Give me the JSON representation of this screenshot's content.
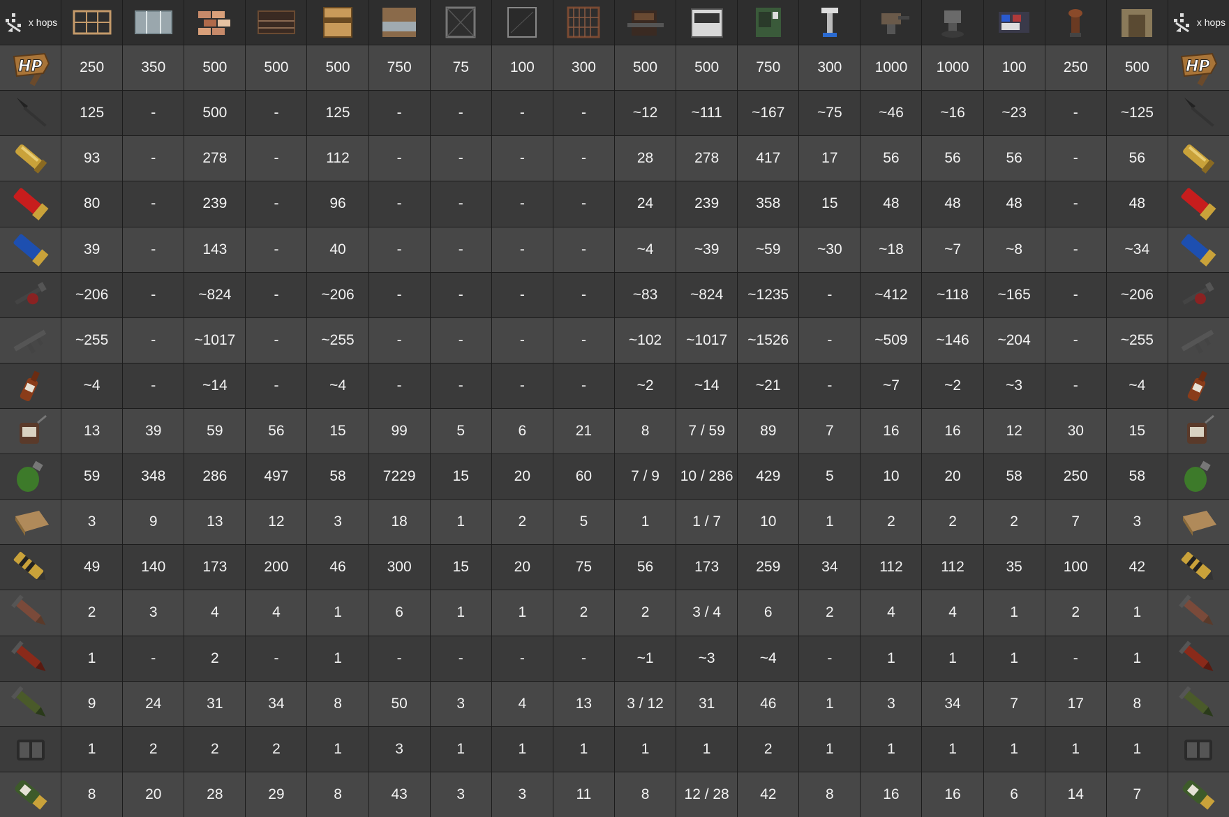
{
  "corner_label": "x hops",
  "hp_label": "HP",
  "colors": {
    "bg_dark": "#3a3a3a",
    "bg_light": "#474747",
    "header": "#2e2e2e",
    "text": "#f2f2f2"
  },
  "targets": [
    {
      "name": "wooden-window-bars",
      "icon": "window-frame-icon"
    },
    {
      "name": "reinforced-glass-window",
      "icon": "glass-window-icon"
    },
    {
      "name": "stone-wall-mixed",
      "icon": "brick-stack-icon"
    },
    {
      "name": "metal-window-bars",
      "icon": "metal-window-bars-icon"
    },
    {
      "name": "wooden-door",
      "icon": "wood-door-icon"
    },
    {
      "name": "armored-door",
      "icon": "garage-door-icon"
    },
    {
      "name": "wire-fence",
      "icon": "wire-fence-icon"
    },
    {
      "name": "glass-panel",
      "icon": "glass-panel-icon"
    },
    {
      "name": "jail-bars",
      "icon": "jail-bars-icon"
    },
    {
      "name": "workbench",
      "icon": "workbench-icon"
    },
    {
      "name": "shop-front",
      "icon": "shop-front-icon"
    },
    {
      "name": "vending-machine",
      "icon": "vending-machine-icon"
    },
    {
      "name": "tesla-coil",
      "icon": "tesla-coil-icon"
    },
    {
      "name": "auto-turret",
      "icon": "auto-turret-icon"
    },
    {
      "name": "sam-site",
      "icon": "sam-site-icon"
    },
    {
      "name": "shelves",
      "icon": "shelves-icon"
    },
    {
      "name": "flame-turret",
      "icon": "flame-turret-icon"
    },
    {
      "name": "wooden-wall-frame",
      "icon": "wall-frame-icon"
    }
  ],
  "rows": [
    {
      "icon": "hp-hammer-icon",
      "values": [
        "250",
        "350",
        "500",
        "500",
        "500",
        "750",
        "75",
        "100",
        "300",
        "500",
        "500",
        "750",
        "300",
        "1000",
        "1000",
        "100",
        "250",
        "500"
      ]
    },
    {
      "icon": "spear-icon",
      "values": [
        "125",
        "-",
        "500",
        "-",
        "125",
        "-",
        "-",
        "-",
        "-",
        "~12",
        "~111",
        "~167",
        "~75",
        "~46",
        "~16",
        "~23",
        "-",
        "~125"
      ]
    },
    {
      "icon": "brass-shell-icon",
      "values": [
        "93",
        "-",
        "278",
        "-",
        "112",
        "-",
        "-",
        "-",
        "-",
        "28",
        "278",
        "417",
        "17",
        "56",
        "56",
        "56",
        "-",
        "56"
      ]
    },
    {
      "icon": "red-shotgun-shell-icon",
      "values": [
        "80",
        "-",
        "239",
        "-",
        "96",
        "-",
        "-",
        "-",
        "-",
        "24",
        "239",
        "358",
        "15",
        "48",
        "48",
        "48",
        "-",
        "48"
      ]
    },
    {
      "icon": "blue-shotgun-shell-icon",
      "values": [
        "39",
        "-",
        "143",
        "-",
        "40",
        "-",
        "-",
        "-",
        "-",
        "~4",
        "~39",
        "~59",
        "~30",
        "~18",
        "~7",
        "~8",
        "-",
        "~34"
      ]
    },
    {
      "icon": "flamethrower-icon",
      "values": [
        "~206",
        "-",
        "~824",
        "-",
        "~206",
        "-",
        "-",
        "-",
        "-",
        "~83",
        "~824",
        "~1235",
        "-",
        "~412",
        "~118",
        "~165",
        "-",
        "~206"
      ]
    },
    {
      "icon": "smg-icon",
      "values": [
        "~255",
        "-",
        "~1017",
        "-",
        "~255",
        "-",
        "-",
        "-",
        "-",
        "~102",
        "~1017",
        "~1526",
        "-",
        "~509",
        "~146",
        "~204",
        "-",
        "~255"
      ]
    },
    {
      "icon": "molotov-icon",
      "values": [
        "~4",
        "-",
        "~14",
        "-",
        "~4",
        "-",
        "-",
        "-",
        "-",
        "~2",
        "~14",
        "~21",
        "-",
        "~7",
        "~2",
        "~3",
        "-",
        "~4"
      ]
    },
    {
      "icon": "beancan-grenade-icon",
      "values": [
        "13",
        "39",
        "59",
        "56",
        "15",
        "99",
        "5",
        "6",
        "21",
        "8",
        "7 / 59",
        "89",
        "7",
        "16",
        "16",
        "12",
        "30",
        "15"
      ]
    },
    {
      "icon": "f1-grenade-icon",
      "values": [
        "59",
        "348",
        "286",
        "497",
        "58",
        "7229",
        "15",
        "20",
        "60",
        "7 / 9",
        "10 / 286",
        "429",
        "5",
        "10",
        "20",
        "58",
        "250",
        "58"
      ]
    },
    {
      "icon": "satchel-charge-icon",
      "values": [
        "3",
        "9",
        "13",
        "12",
        "3",
        "18",
        "1",
        "2",
        "5",
        "1",
        "1 / 7",
        "10",
        "1",
        "2",
        "2",
        "2",
        "7",
        "3"
      ]
    },
    {
      "icon": "explosive-ammo-icon",
      "values": [
        "49",
        "140",
        "173",
        "200",
        "46",
        "300",
        "15",
        "20",
        "75",
        "56",
        "173",
        "259",
        "34",
        "112",
        "112",
        "35",
        "100",
        "42"
      ]
    },
    {
      "icon": "rocket-icon",
      "values": [
        "2",
        "3",
        "4",
        "4",
        "1",
        "6",
        "1",
        "1",
        "2",
        "2",
        "3 / 4",
        "6",
        "2",
        "4",
        "4",
        "1",
        "2",
        "1"
      ]
    },
    {
      "icon": "incendiary-rocket-icon",
      "values": [
        "1",
        "-",
        "2",
        "-",
        "1",
        "-",
        "-",
        "-",
        "-",
        "~1",
        "~3",
        "~4",
        "-",
        "1",
        "1",
        "1",
        "-",
        "1"
      ]
    },
    {
      "icon": "hv-rocket-icon",
      "values": [
        "9",
        "24",
        "31",
        "34",
        "8",
        "50",
        "3",
        "4",
        "13",
        "3 / 12",
        "31",
        "46",
        "1",
        "3",
        "34",
        "7",
        "17",
        "8"
      ]
    },
    {
      "icon": "c4-timed-explosive-icon",
      "values": [
        "1",
        "2",
        "2",
        "2",
        "1",
        "3",
        "1",
        "1",
        "1",
        "1",
        "1",
        "2",
        "1",
        "1",
        "1",
        "1",
        "1",
        "1"
      ]
    },
    {
      "icon": "grenade-launcher-he-icon",
      "values": [
        "8",
        "20",
        "28",
        "29",
        "8",
        "43",
        "3",
        "3",
        "11",
        "8",
        "12 / 28",
        "42",
        "8",
        "16",
        "16",
        "6",
        "14",
        "7"
      ]
    }
  ]
}
